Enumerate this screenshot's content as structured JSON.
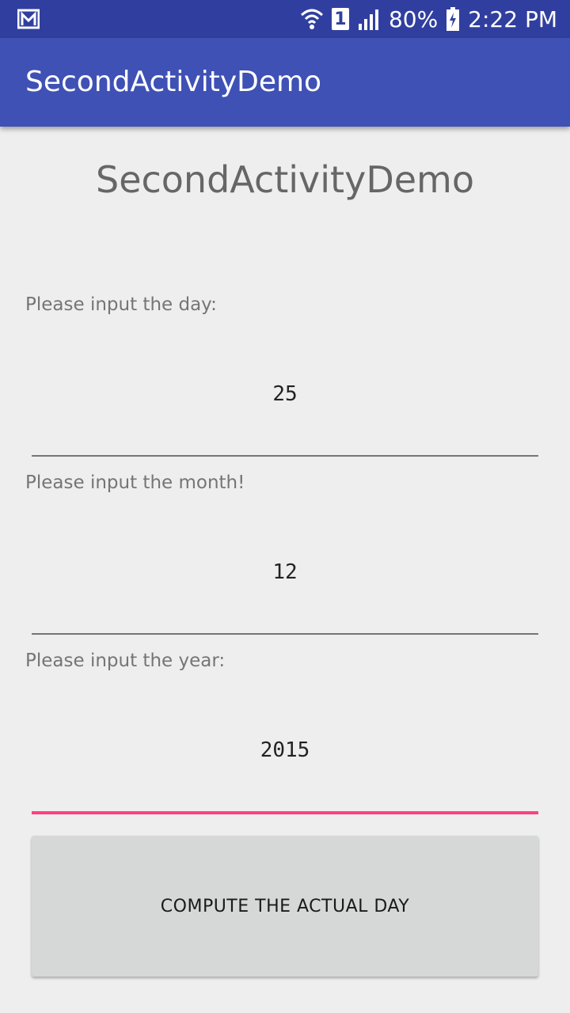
{
  "status_bar": {
    "notification_icon": "gmail-icon",
    "wifi_icon": "wifi-icon",
    "sim_label": "1",
    "signal_icon": "cell-signal-icon",
    "battery_percent": "80%",
    "battery_icon": "battery-charging-icon",
    "time": "2:22 PM"
  },
  "app_bar": {
    "title": "SecondActivityDemo"
  },
  "main": {
    "heading": "SecondActivityDemo",
    "fields": [
      {
        "label": "Please input the day:",
        "value": "25"
      },
      {
        "label": "Please input the month!",
        "value": "12"
      },
      {
        "label": "Please input the year:",
        "value": "2015"
      }
    ],
    "button_label": "COMPUTE THE ACTUAL DAY"
  },
  "colors": {
    "status_bar": "#303f9f",
    "app_bar": "#3f51b5",
    "accent": "#ff4081",
    "background": "#eeeeee",
    "button": "#d6d7d7"
  }
}
